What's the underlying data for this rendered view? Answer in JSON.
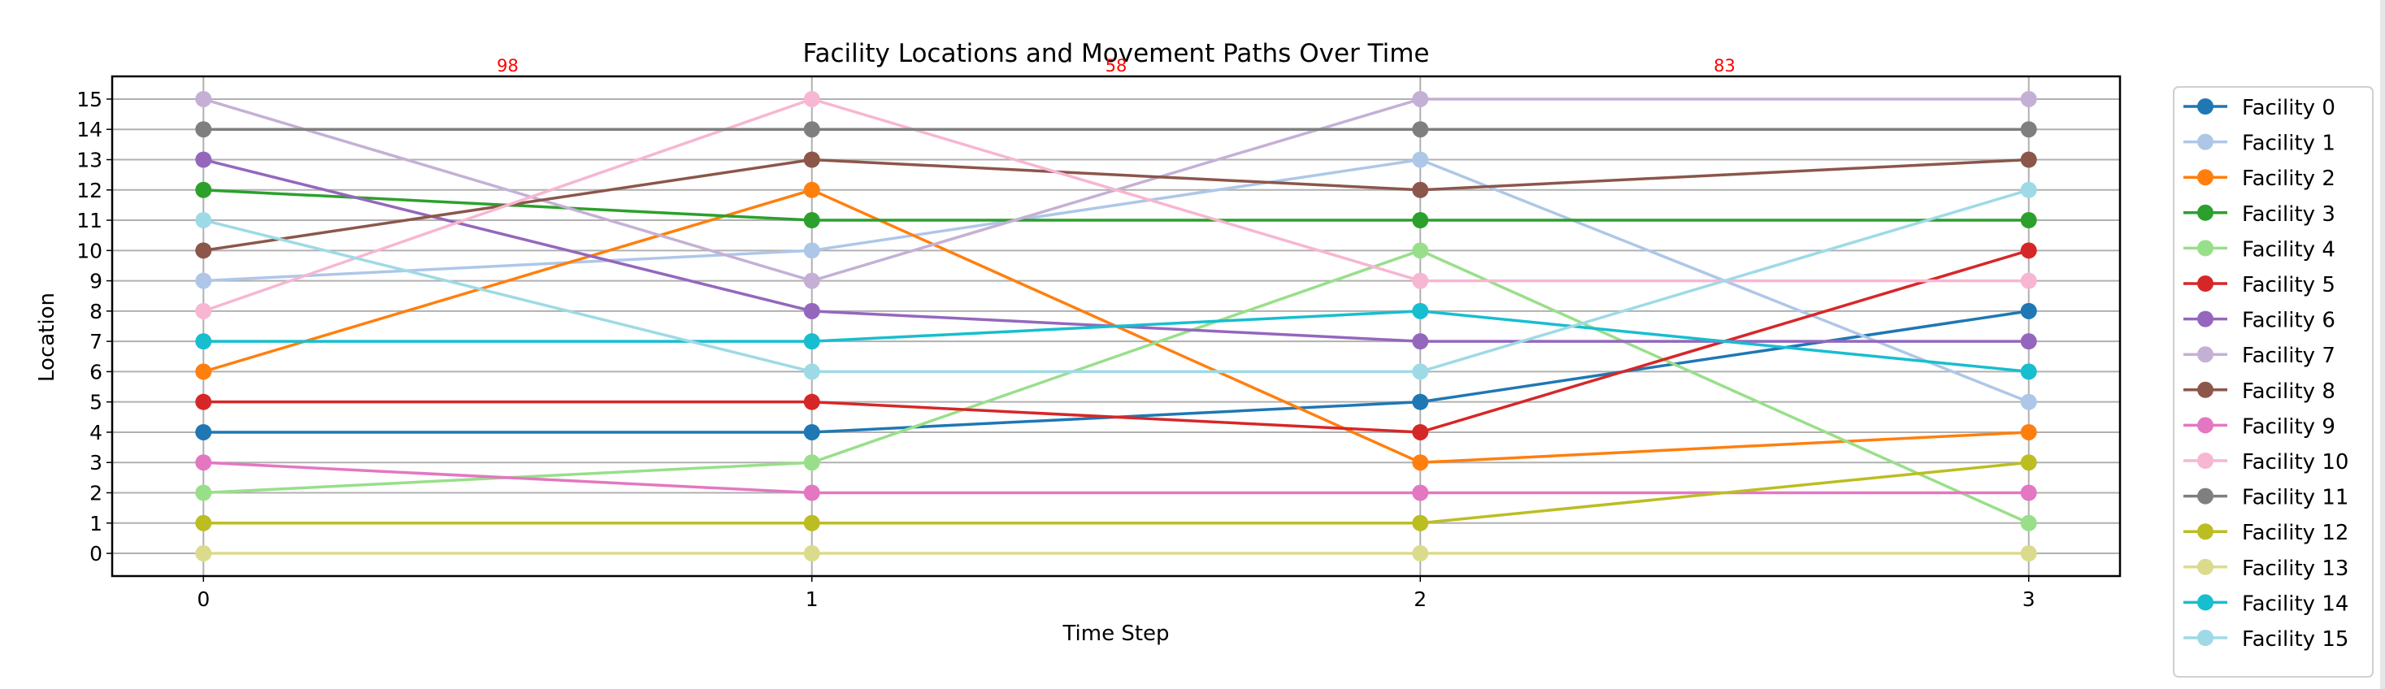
{
  "chart_data": {
    "type": "line",
    "title": "Facility Locations and Movement Paths Over Time",
    "xlabel": "Time Step",
    "ylabel": "Location",
    "x": [
      0,
      1,
      2,
      3
    ],
    "xticks": [
      "0",
      "1",
      "2",
      "3"
    ],
    "yticks": [
      "0",
      "1",
      "2",
      "3",
      "4",
      "5",
      "6",
      "7",
      "8",
      "9",
      "10",
      "11",
      "12",
      "13",
      "14",
      "15"
    ],
    "xlim": [
      -0.15,
      3.15
    ],
    "ylim": [
      -0.75,
      15.75
    ],
    "grid": true,
    "markers": "circle",
    "legend_position": "outside-right",
    "series": [
      {
        "name": "Facility 0",
        "color": "#1f77b4",
        "values": [
          4,
          4,
          5,
          8
        ]
      },
      {
        "name": "Facility 1",
        "color": "#aec7e8",
        "values": [
          9,
          10,
          13,
          5
        ]
      },
      {
        "name": "Facility 2",
        "color": "#ff7f0e",
        "values": [
          6,
          12,
          3,
          4
        ]
      },
      {
        "name": "Facility 3",
        "color": "#2ca02c",
        "values": [
          12,
          11,
          11,
          11
        ]
      },
      {
        "name": "Facility 4",
        "color": "#98df8a",
        "values": [
          2,
          3,
          10,
          1
        ]
      },
      {
        "name": "Facility 5",
        "color": "#d62728",
        "values": [
          5,
          5,
          4,
          10
        ]
      },
      {
        "name": "Facility 6",
        "color": "#9467bd",
        "values": [
          13,
          8,
          7,
          7
        ]
      },
      {
        "name": "Facility 7",
        "color": "#c5b0d5",
        "values": [
          15,
          9,
          15,
          15
        ]
      },
      {
        "name": "Facility 8",
        "color": "#8c564b",
        "values": [
          10,
          13,
          12,
          13
        ]
      },
      {
        "name": "Facility 9",
        "color": "#e377c2",
        "values": [
          3,
          2,
          2,
          2
        ]
      },
      {
        "name": "Facility 10",
        "color": "#f7b6d2",
        "values": [
          8,
          15,
          9,
          9
        ]
      },
      {
        "name": "Facility 11",
        "color": "#7f7f7f",
        "values": [
          14,
          14,
          14,
          14
        ]
      },
      {
        "name": "Facility 12",
        "color": "#bcbd22",
        "values": [
          1,
          1,
          1,
          3
        ]
      },
      {
        "name": "Facility 13",
        "color": "#dbdb8d",
        "values": [
          0,
          0,
          0,
          0
        ]
      },
      {
        "name": "Facility 14",
        "color": "#17becf",
        "values": [
          7,
          7,
          8,
          6
        ]
      },
      {
        "name": "Facility 15",
        "color": "#9edae5",
        "values": [
          11,
          6,
          6,
          12
        ]
      }
    ],
    "annotations": [
      {
        "text": "98",
        "x": 0.5,
        "color": "#ff0000"
      },
      {
        "text": "58",
        "x": 1.5,
        "color": "#ff0000"
      },
      {
        "text": "83",
        "x": 2.5,
        "color": "#ff0000"
      }
    ]
  }
}
